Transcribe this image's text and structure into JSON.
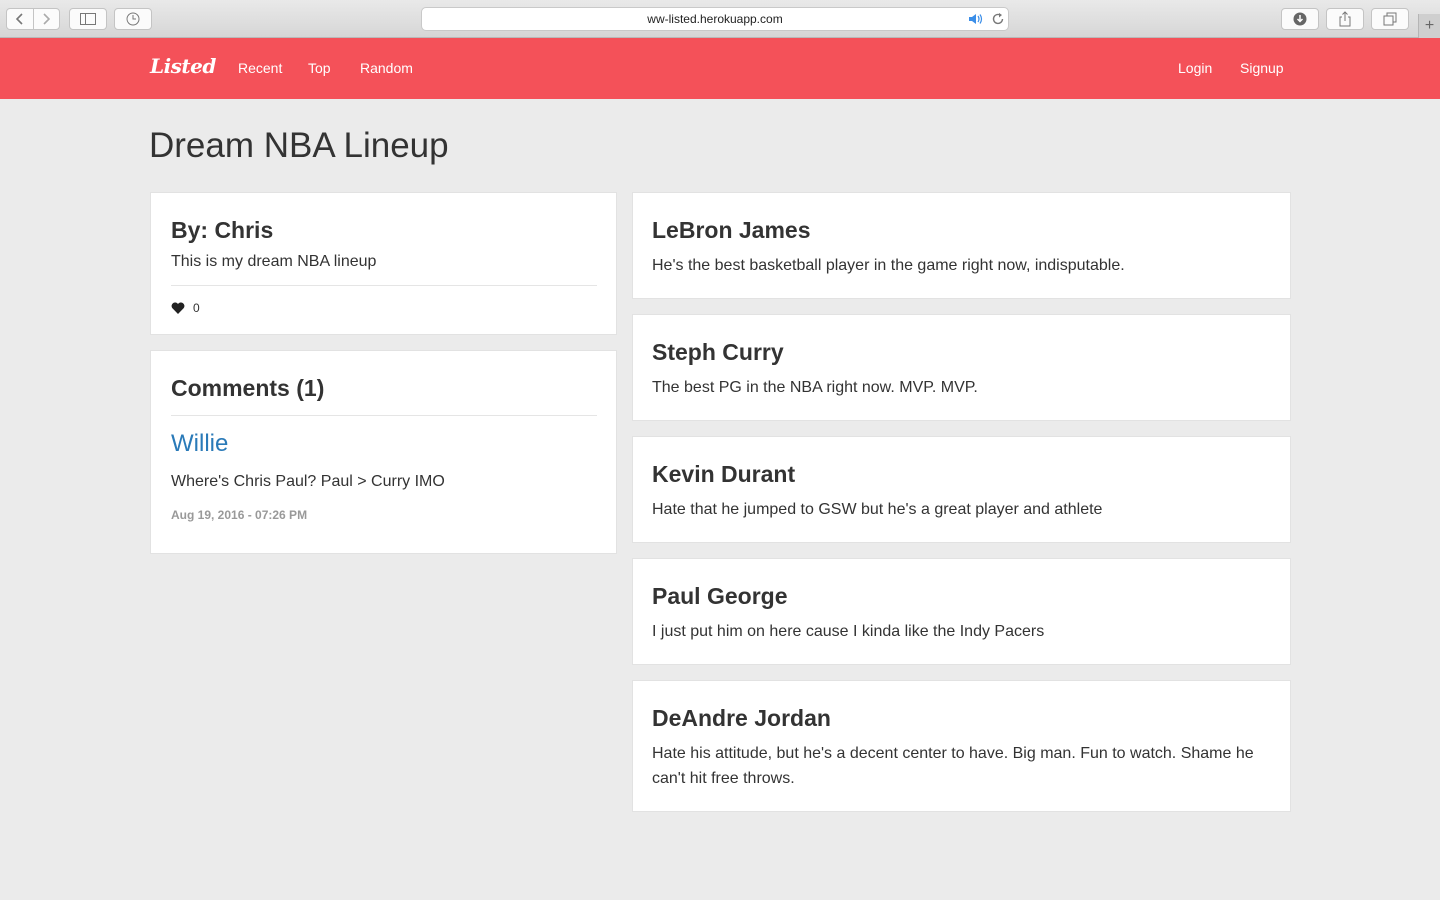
{
  "browser": {
    "url": "ww-listed.herokuapp.com"
  },
  "nav": {
    "logo": "Listed",
    "recent": "Recent",
    "top": "Top",
    "random": "Random",
    "login": "Login",
    "signup": "Signup"
  },
  "list": {
    "title": "Dream NBA Lineup",
    "author": "By: Chris",
    "description": "This is my dream NBA lineup",
    "likes": "0"
  },
  "comments": {
    "heading": "Comments (1)",
    "items": [
      {
        "author": "Willie",
        "text": "Where's Chris Paul? Paul > Curry IMO",
        "date": "Aug 19, 2016 - 07:26 PM"
      }
    ]
  },
  "items": [
    {
      "name": "LeBron James",
      "text": "He's the best basketball player in the game right now, indisputable."
    },
    {
      "name": "Steph Curry",
      "text": "The best PG in the NBA right now. MVP. MVP."
    },
    {
      "name": "Kevin Durant",
      "text": "Hate that he jumped to GSW but he's a great player and athlete"
    },
    {
      "name": "Paul George",
      "text": "I just put him on here cause I kinda like the Indy Pacers"
    },
    {
      "name": "DeAndre Jordan",
      "text": "Hate his attitude, but he's a decent center to have. Big man. Fun to watch. Shame he can't hit free throws."
    }
  ],
  "icons": {
    "back": "chevron-left-icon",
    "forward": "chevron-right-icon",
    "sidebar": "sidebar-icon",
    "history": "clock-icon",
    "speaker": "speaker-icon",
    "reload": "reload-icon",
    "download": "download-icon",
    "share": "share-icon",
    "tabs": "tabs-icon",
    "new_tab": "plus-icon",
    "like": "heart-icon"
  },
  "colors": {
    "brand": "#f45159",
    "link": "#2a7ab8",
    "background": "#ebebeb"
  }
}
